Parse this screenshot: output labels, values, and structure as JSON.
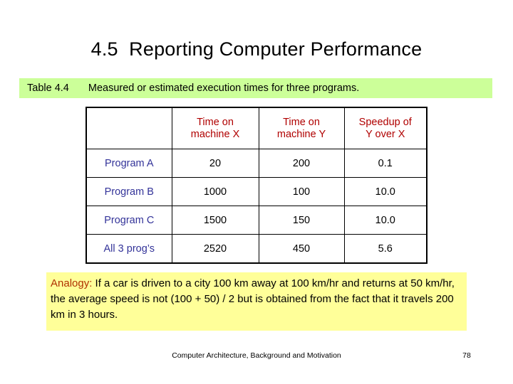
{
  "slide": {
    "title": "4.5  Reporting Computer Performance"
  },
  "caption": {
    "label": "Table 4.4",
    "text": "Measured or estimated execution times for three programs.",
    "background_color": "#ccff99"
  },
  "table": {
    "headers": [
      {
        "line1": "",
        "line2": ""
      },
      {
        "line1": "Time on",
        "line2": "machine X"
      },
      {
        "line1": "Time on",
        "line2": "machine Y"
      },
      {
        "line1": "Speedup of",
        "line2": "Y over X"
      }
    ],
    "header_color": "#b00000",
    "row_label_color": "#333399",
    "rows": [
      {
        "label": "Program A",
        "time_x": "20",
        "time_y": "200",
        "speedup": "0.1"
      },
      {
        "label": "Program B",
        "time_x": "1000",
        "time_y": "100",
        "speedup": "10.0"
      },
      {
        "label": "Program C",
        "time_x": "1500",
        "time_y": "150",
        "speedup": "10.0"
      },
      {
        "label": "All 3 prog’s",
        "time_x": "2520",
        "time_y": "450",
        "speedup": "5.6"
      }
    ]
  },
  "analogy": {
    "label": "Analogy:",
    "text": " If a car is driven to a city 100 km away at 100 km/hr and returns at 50 km/hr, the average speed is not (100 + 50) / 2 but is obtained from the fact that it travels 200 km in 3 hours.",
    "background_color": "#ffff99",
    "label_color": "#b03000"
  },
  "footer": {
    "text": "Computer Architecture, Background and Motivation",
    "page": "78"
  }
}
